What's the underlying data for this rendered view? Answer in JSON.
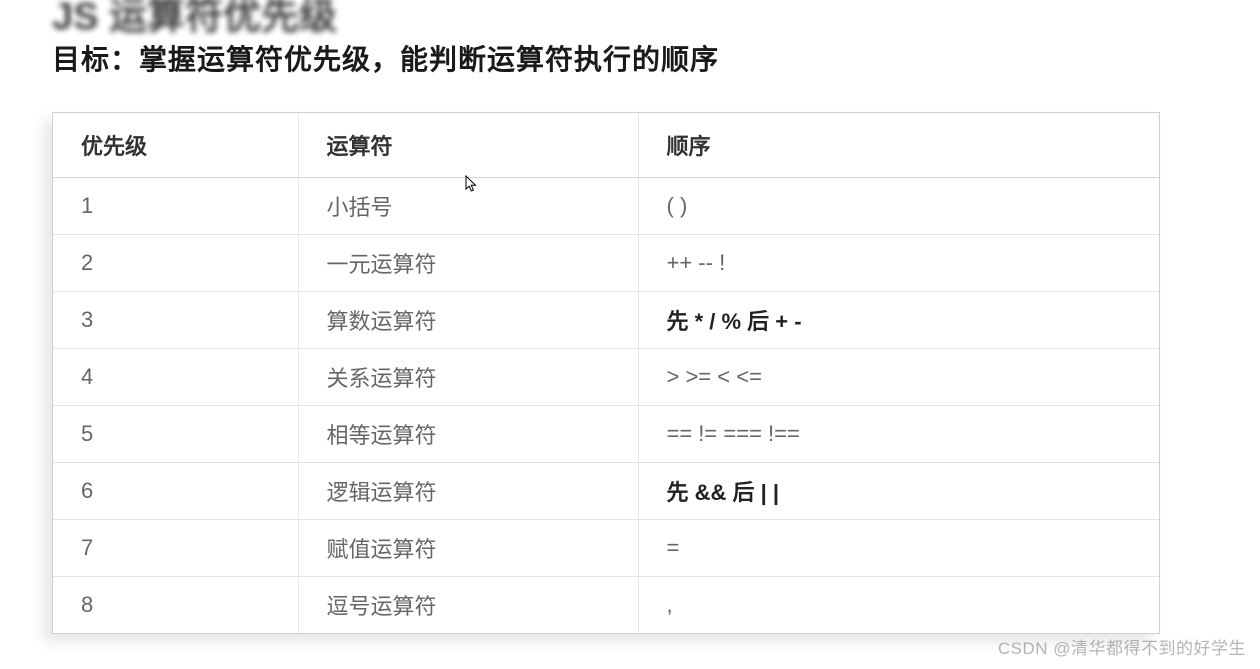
{
  "header": {
    "title_blur": "JS 运算符优先级",
    "goal": "目标：掌握运算符优先级，能判断运算符执行的顺序"
  },
  "table": {
    "headers": [
      "优先级",
      "运算符",
      "顺序"
    ],
    "rows": [
      {
        "priority": "1",
        "name": "小括号",
        "order": " ( )",
        "bold": false
      },
      {
        "priority": "2",
        "name": "一元运算符",
        "order": "++   --   !",
        "bold": false
      },
      {
        "priority": "3",
        "name": "算数运算符",
        "order": "先 * / %  后 + -",
        "bold": true
      },
      {
        "priority": "4",
        "name": "关系运算符",
        "order": ">   >=   <   <=",
        "bold": false
      },
      {
        "priority": "5",
        "name": "相等运算符",
        "order": "==   !=    ===    !==",
        "bold": false
      },
      {
        "priority": "6",
        "name": "逻辑运算符",
        "order": "先 &&   后 | |",
        "bold": true
      },
      {
        "priority": "7",
        "name": "赋值运算符",
        "order": "=",
        "bold": false
      },
      {
        "priority": "8",
        "name": "逗号运算符",
        "order": ",",
        "bold": false
      }
    ]
  },
  "watermark": "CSDN @清华都得不到的好学生"
}
